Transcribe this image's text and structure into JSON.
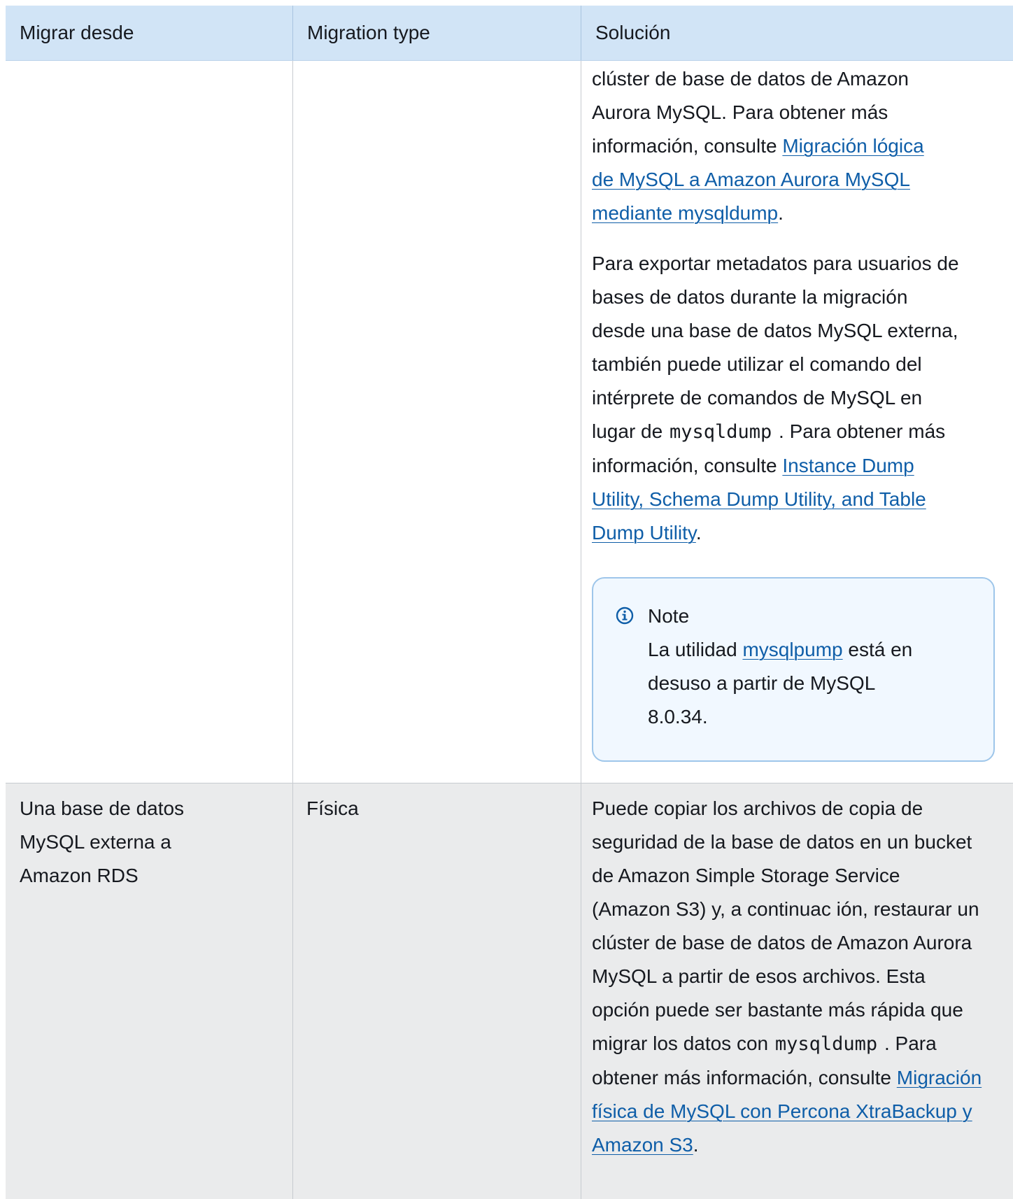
{
  "table": {
    "headers": [
      "Migrar desde",
      "Migration type",
      "Solución"
    ],
    "row1": {
      "col3": {
        "p1_text": "clúster de base de datos de Amazon Aurora MySQL. Para obtener más información, consulte ",
        "p1_link": "Migración lógica de MySQL a Amazon Aurora MySQL mediante mysqldump",
        "p1_end": ".",
        "p2_text_a": "Para exportar metadatos para usuarios de bases de datos durante la migración desde una base de datos MySQL externa, también puede utilizar el comando del intérprete de comandos de MySQL en lugar de ",
        "p2_code": "mysqldump",
        "p2_text_b": " . Para obtener más información, consulte ",
        "p2_link": "Instance Dump Utility, Schema Dump Utility, and Table Dump Utility",
        "p2_end": "."
      },
      "note": {
        "title": "Note",
        "text_a": "La utilidad ",
        "link": "mysqlpump",
        "text_b": " está en desuso a partir de MySQL 8.0.34."
      }
    },
    "row2": {
      "col1": "Una base de datos MySQL externa a Amazon RDS",
      "col2": "Física",
      "col3": {
        "text_a": "Puede copiar los archivos de copia de seguridad de la base de datos en un bucket de Amazon Simple Storage Service (Amazon S3) y, a continuac ión, restaurar un clúster de base de datos de Amazon Aurora MySQL a partir de esos archivos. Esta opción puede ser bastante más rápida que migrar los datos con ",
        "code": "mysqldump",
        "text_b": " . Para obtener más información, consulte ",
        "link": "Migración física de MySQL con Percona XtraBackup y Amazon S3",
        "end": "."
      }
    }
  },
  "colors": {
    "header_bg": "#d1e4f6",
    "link": "#0f5ea8",
    "row_alt_bg": "#eaebec",
    "note_border": "#9ec6ea",
    "note_bg": "#f1f8ff",
    "info_icon": "#0f5ea8"
  },
  "icons": {
    "note": "info-circle-icon"
  }
}
